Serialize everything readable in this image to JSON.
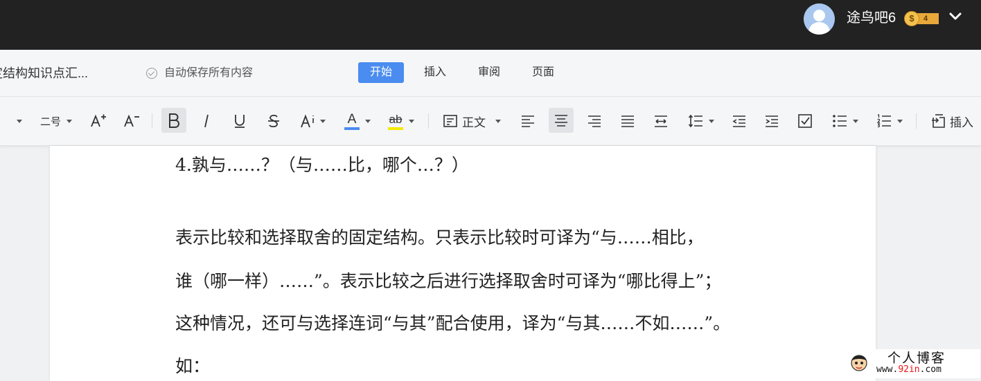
{
  "user": {
    "name": "途鸟吧6",
    "coin_symbol": "$",
    "coin_count": "4"
  },
  "doc": {
    "title": "定结构知识点汇...",
    "autosave": "自动保存所有内容"
  },
  "tabs": [
    {
      "label": "开始"
    },
    {
      "label": "插入"
    },
    {
      "label": "审阅"
    },
    {
      "label": "页面"
    }
  ],
  "toolbar": {
    "font_size": "二号",
    "font_color": "A",
    "highlight": "ab",
    "paragraph_style": "正文",
    "insert": "插入",
    "colors": {
      "font_color_bar": "#4a8cf0",
      "highlight_bar": "#f5e900"
    }
  },
  "content": {
    "heading": "4.孰与……？（与……比，哪个…？）",
    "paragraph_lines": [
      "表示比较和选择取舍的固定结构。只表示比较时可译为“与……相比，",
      "谁（哪一样）……”。表示比较之后进行选择取舍时可译为“哪比得上”；",
      "这种情况，还可与选择连词“与其”配合使用，译为“与其……不如……”。",
      "如："
    ]
  },
  "watermark": {
    "line1": "个人博客",
    "line2_prefix": "www.",
    "line2_brand": "92in",
    "line2_suffix": ".com"
  },
  "colors": {
    "topbar": "#222222",
    "accent": "#4a8cf0"
  }
}
